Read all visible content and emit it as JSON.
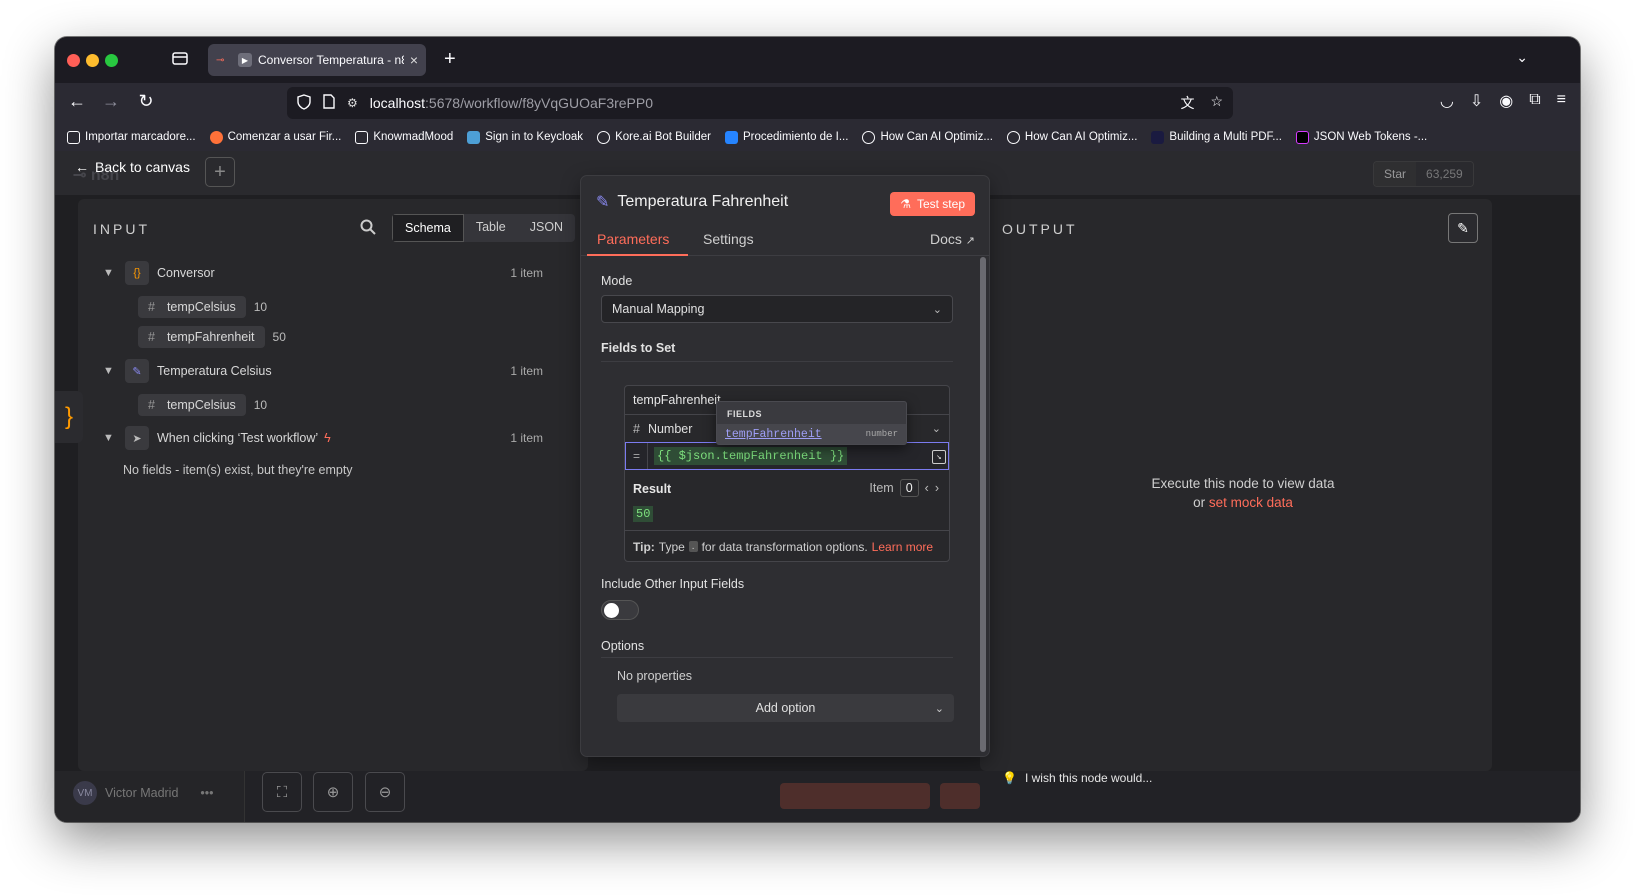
{
  "browser": {
    "tab_title": "Conversor Temperatura - n8",
    "url_host": "localhost",
    "url_path": ":5678/workflow/f8yVqGUOaF3rePP0",
    "bookmarks": [
      {
        "label": "Importar marcadore...",
        "color": "#fbfbfe"
      },
      {
        "label": "Comenzar a usar Fir...",
        "color": "#ff7139"
      },
      {
        "label": "KnowmadMood",
        "color": "#fbfbfe"
      },
      {
        "label": "Sign in to Keycloak",
        "color": "#4d9fd6"
      },
      {
        "label": "Kore.ai Bot Builder",
        "color": "#fbfbfe"
      },
      {
        "label": "Procedimiento de I...",
        "color": "#2684ff"
      },
      {
        "label": "How Can AI Optimiz...",
        "color": "#fbfbfe"
      },
      {
        "label": "How Can AI Optimiz...",
        "color": "#fbfbfe"
      },
      {
        "label": "Building a Multi PDF...",
        "color": "#4b6bfb"
      },
      {
        "label": "JSON Web Tokens -...",
        "color": "#d63aff"
      }
    ]
  },
  "header": {
    "back_label": "Back to canvas",
    "github_star": "Star",
    "github_count": "63,259"
  },
  "input": {
    "title": "INPUT",
    "tabs": [
      "Schema",
      "Table",
      "JSON"
    ],
    "active_tab": "Schema",
    "nodes": [
      {
        "name": "Conversor",
        "count": "1 item",
        "fields": [
          {
            "name": "tempCelsius",
            "value": "10"
          },
          {
            "name": "tempFahrenheit",
            "value": "50"
          }
        ]
      },
      {
        "name": "Temperatura Celsius",
        "count": "1 item",
        "fields": [
          {
            "name": "tempCelsius",
            "value": "10"
          }
        ]
      },
      {
        "name": "When clicking ‘Test workflow’",
        "count": "1 item",
        "fields": []
      }
    ],
    "empty_message": "No fields - item(s) exist, but they're empty"
  },
  "output": {
    "title": "OUTPUT",
    "message_line1": "Execute this node to view data",
    "message_or": "or",
    "mock_link": "set mock data"
  },
  "node": {
    "title": "Temperatura Fahrenheit",
    "test_button": "Test step",
    "tabs": {
      "parameters": "Parameters",
      "settings": "Settings",
      "docs": "Docs"
    },
    "mode_label": "Mode",
    "mode_value": "Manual Mapping",
    "fields_to_set_label": "Fields to Set",
    "field": {
      "name": "tempFahrenheit",
      "type": "Number",
      "expression": "{{ $json.tempFahrenheit }}",
      "result_label": "Result",
      "item_label": "Item",
      "item_index": "0",
      "result_value": "50",
      "tip_bold": "Tip:",
      "tip_text1": "Type",
      "tip_dot": ".",
      "tip_text2": "for data transformation options.",
      "tip_link": "Learn more"
    },
    "autocomplete": {
      "header": "FIELDS",
      "item_name": "tempFahrenheit",
      "item_type": "number"
    },
    "include_other_label": "Include Other Input Fields",
    "include_other_enabled": false,
    "options_label": "Options",
    "no_properties": "No properties",
    "add_option": "Add option"
  },
  "footer": {
    "user_initials": "VM",
    "user_name": "Victor Madrid",
    "wish_text": "I wish this node would..."
  },
  "colors": {
    "accent": "#ff6d5a",
    "expression_green": "#7ee07e",
    "node_icon_purple": "#8b8bf5"
  }
}
